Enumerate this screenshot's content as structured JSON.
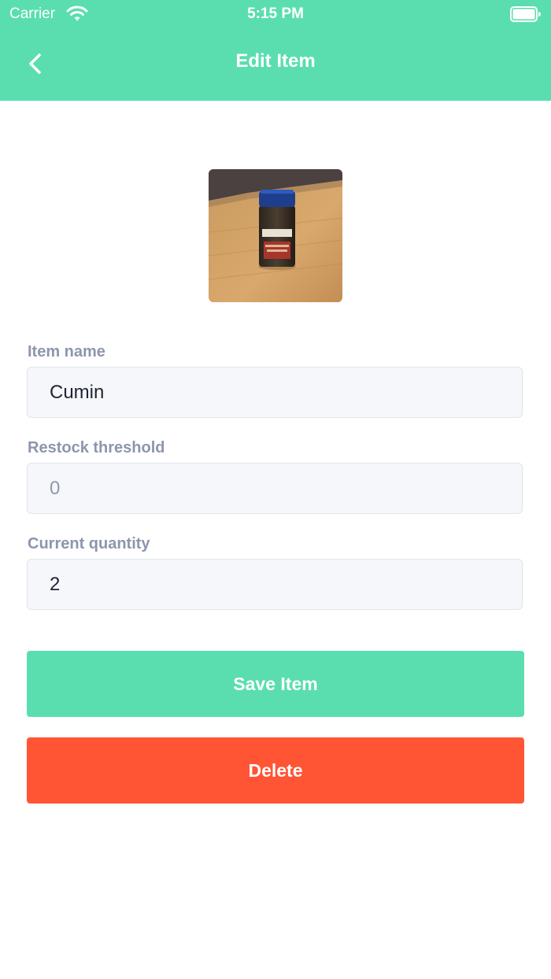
{
  "status_bar": {
    "carrier": "Carrier",
    "time": "5:15 PM"
  },
  "nav": {
    "title": "Edit Item"
  },
  "form": {
    "item_name_label": "Item name",
    "item_name_value": "Cumin",
    "restock_label": "Restock threshold",
    "restock_placeholder": "0",
    "quantity_label": "Current quantity",
    "quantity_value": "2"
  },
  "actions": {
    "save_label": "Save Item",
    "delete_label": "Delete"
  },
  "colors": {
    "brand": "#5ADEB0",
    "danger": "#FF5535",
    "label": "#8C96AC"
  }
}
